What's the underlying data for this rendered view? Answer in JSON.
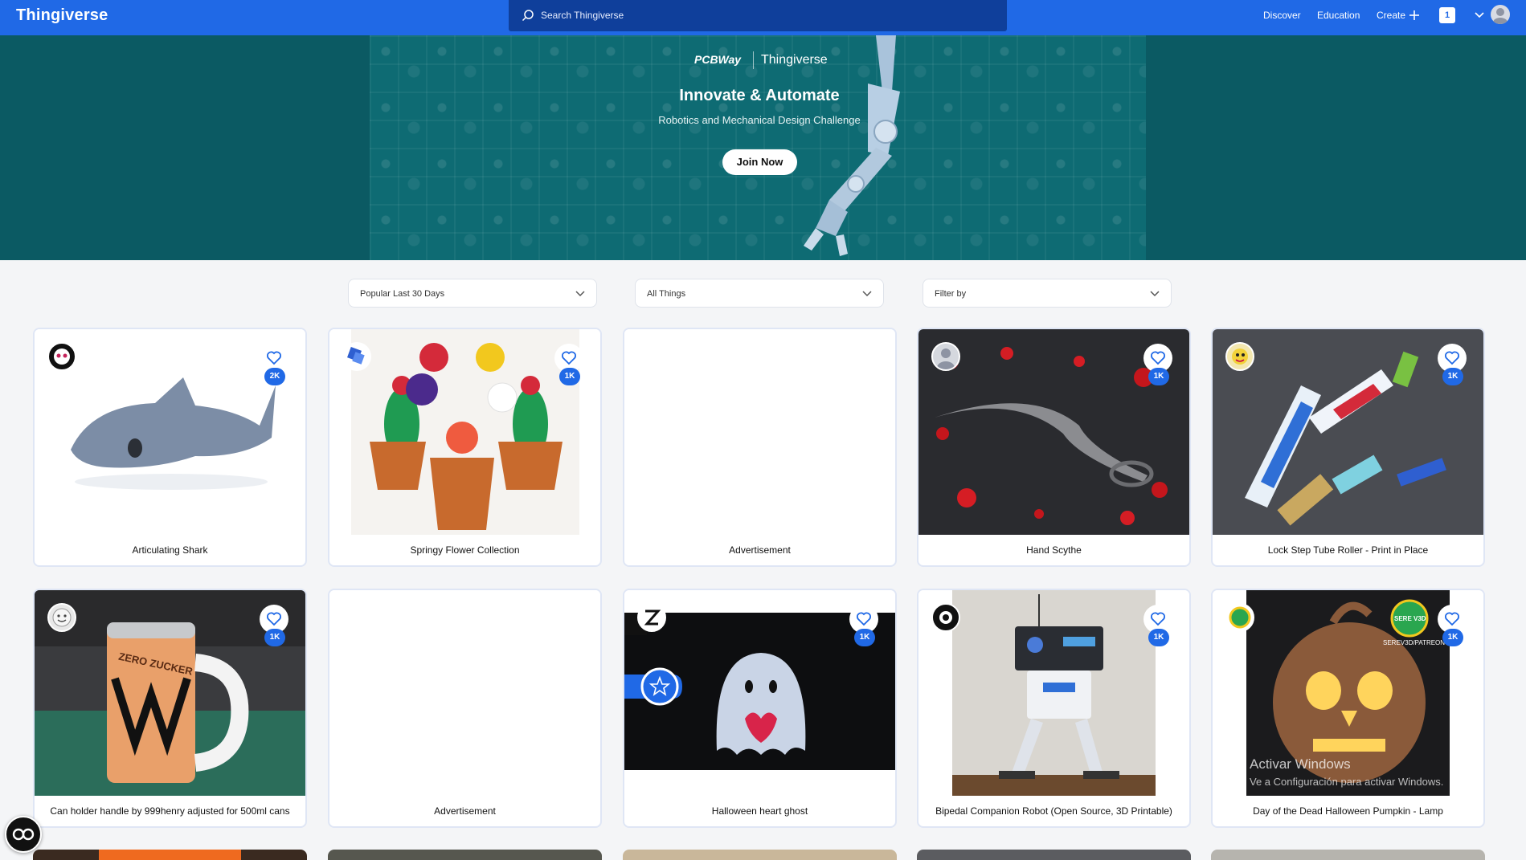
{
  "app": {
    "brand": "Thingiverse"
  },
  "search": {
    "placeholder": "Search Thingiverse"
  },
  "nav": {
    "discover": "Discover",
    "education": "Education",
    "create": "Create",
    "notifications": "1"
  },
  "hero": {
    "logo_left": "PCBWay",
    "logo_right": "Thingiverse",
    "title": "Innovate & Automate",
    "subtitle": "Robotics and Mechanical Design Challenge",
    "cta": "Join Now"
  },
  "filters": {
    "sort": "Popular Last 30 Days",
    "category": "All Things",
    "filter_by": "Filter by"
  },
  "cards": [
    {
      "title": "Articulating Shark",
      "likes": "2K"
    },
    {
      "title": "Springy Flower Collection",
      "likes": "1K"
    },
    {
      "title": "Advertisement"
    },
    {
      "title": "Hand Scythe",
      "likes": "1K"
    },
    {
      "title": "Lock Step Tube Roller - Print in Place",
      "likes": "1K"
    },
    {
      "title": "Can holder handle by 999henry adjusted for 500ml cans",
      "likes": "1K"
    },
    {
      "title": "Advertisement"
    },
    {
      "title": "Halloween heart ghost",
      "likes": "1K"
    },
    {
      "title": "Bipedal Companion Robot (Open Source, 3D Printable)",
      "likes": "1K"
    },
    {
      "title": "Day of the Dead Halloween Pumpkin - Lamp",
      "likes": "1K"
    }
  ],
  "overlays": {
    "can_brand_text": "ZERO ZUCKER",
    "pumpkin_creator_tag": "SERE V3D",
    "pumpkin_patreon": "SEREV3D/PATREON",
    "watermark_title": "Activar Windows",
    "watermark_sub": "Ve a Configuración para activar Windows."
  },
  "colors": {
    "primary": "#2069e6",
    "search_bg": "#0f3f9b",
    "hero_bg": "#0b5a63"
  }
}
